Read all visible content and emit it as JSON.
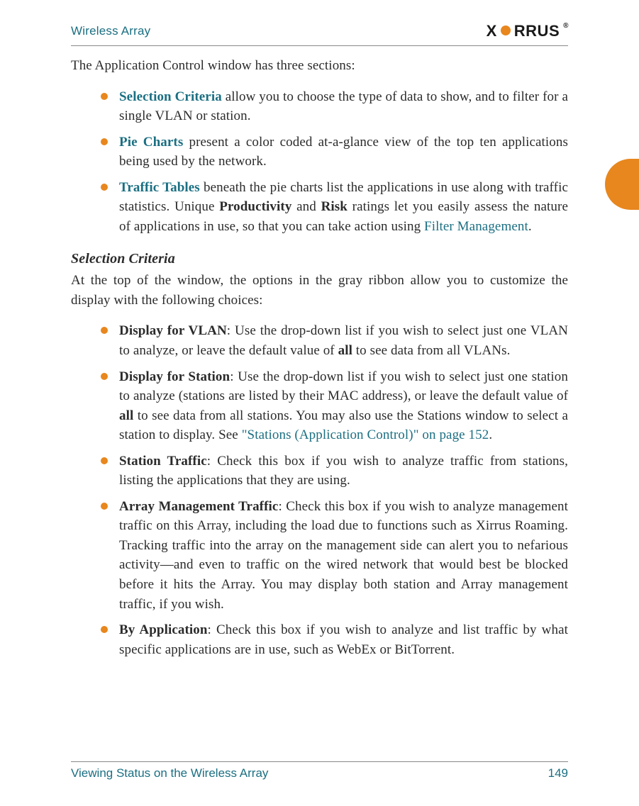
{
  "header": {
    "title": "Wireless Array",
    "logo_prefix": "X",
    "logo_suffix": "RRUS",
    "logo_reg": "®"
  },
  "intro": "The Application Control window has three sections:",
  "sections_list": [
    {
      "link": "Selection Criteria",
      "rest": " allow you to choose the type of data to show, and to filter for a single VLAN or station."
    },
    {
      "link": "Pie Charts",
      "rest": " present a color coded at-a-glance view of the top ten applications being used by the network."
    },
    {
      "link": "Traffic Tables",
      "rest_1": " beneath the pie charts list the applications in use along with traffic statistics. Unique ",
      "bold_1": "Productivity",
      "rest_2": " and ",
      "bold_2": "Risk",
      "rest_3": " ratings let you easily assess the nature of applications in use, so that you can take action using ",
      "link_2": "Filter Management",
      "rest_4": "."
    }
  ],
  "subhead": "Selection Criteria",
  "subhead_para": "At the top of the window, the options in the gray ribbon allow you to customize the display with the following choices:",
  "criteria": [
    {
      "bold": "Display for VLAN",
      "rest_1": ": Use the drop-down list if you wish to select just one VLAN to analyze, or leave the default value of ",
      "bold_inline": "all",
      "rest_2": " to see data from all VLANs."
    },
    {
      "bold": "Display for Station",
      "rest_1": ": Use the drop-down list if you wish to select just one station to analyze (stations are listed by their MAC address), or leave the default value of ",
      "bold_inline": "all",
      "rest_2": " to see data from all stations. You may also use the Stations window to select a station to display. See ",
      "link": "\"Stations (Application Control)\" on page 152",
      "rest_3": "."
    },
    {
      "bold": "Station Traffic",
      "rest_1": ": Check this box if you wish to analyze traffic from stations, listing the applications that they are using."
    },
    {
      "bold": "Array Management Traffic",
      "rest_1": ": Check this box if you wish to analyze management traffic on this Array, including the load due to functions such as Xirrus Roaming. Tracking traffic into the array on the management side can alert you to nefarious activity—and even to traffic on the wired network that would best be blocked before it hits the Array. You may display both station and Array management traffic, if you wish."
    },
    {
      "bold": "By Application",
      "rest_1": ": Check this box if you wish to analyze and list traffic by what specific applications are in use, such as WebEx or BitTorrent."
    }
  ],
  "footer": {
    "left": "Viewing Status on the Wireless Array",
    "right": "149"
  }
}
